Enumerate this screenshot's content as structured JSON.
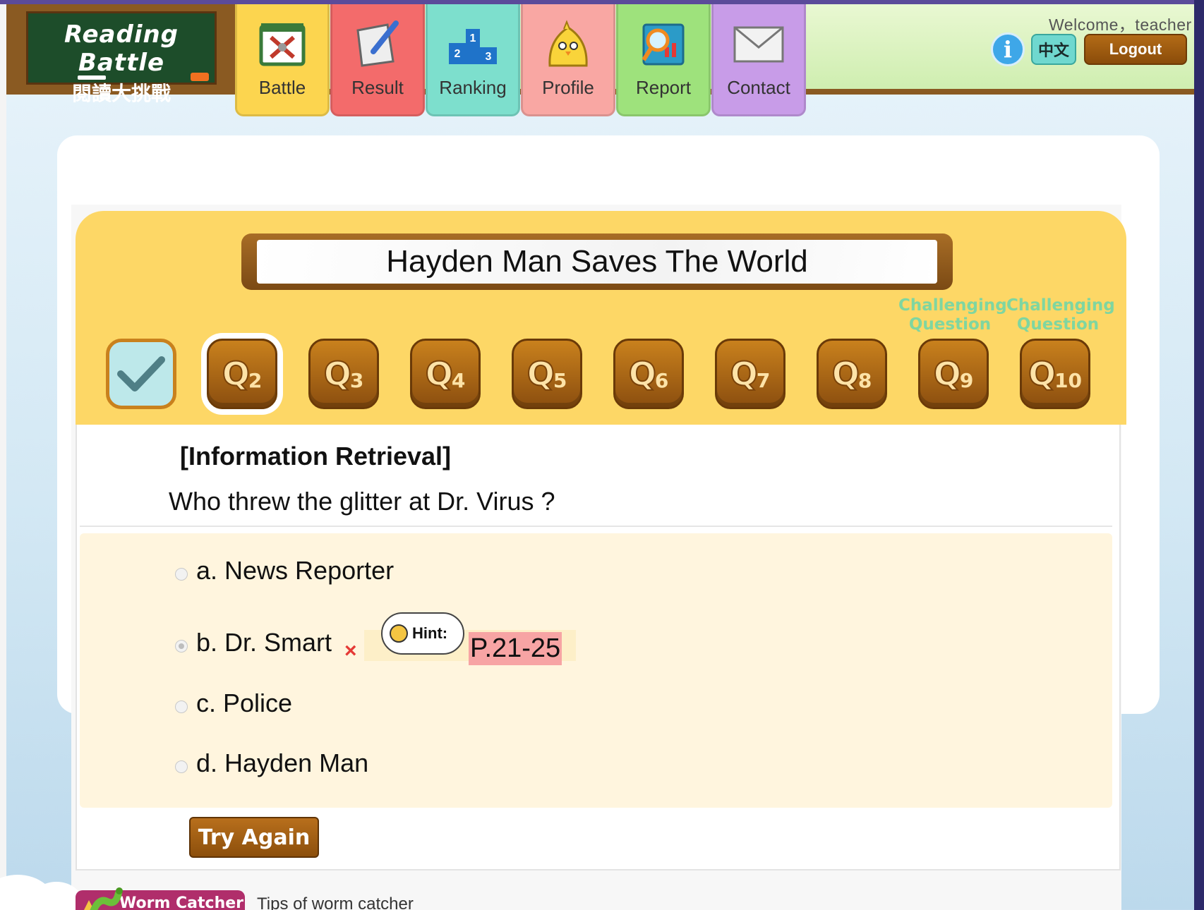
{
  "header": {
    "logo_title": "Reading Battle",
    "logo_subtitle": "閱讀大挑戰",
    "welcome": "Welcome，teacher",
    "info_label": "i",
    "lang_label": "中文",
    "logout_label": "Logout"
  },
  "nav": [
    {
      "label": "Battle",
      "icon": "battle-icon",
      "color": "#fcd54f"
    },
    {
      "label": "Result",
      "icon": "result-icon",
      "color": "#f36b6b"
    },
    {
      "label": "Ranking",
      "icon": "ranking-icon",
      "color": "#7ddfcd"
    },
    {
      "label": "Profile",
      "icon": "profile-icon",
      "color": "#f9a7a3"
    },
    {
      "label": "Report",
      "icon": "report-icon",
      "color": "#9ee27c"
    },
    {
      "label": "Contact",
      "icon": "contact-icon",
      "color": "#c89ce8"
    }
  ],
  "quiz": {
    "book_title": "Hayden Man Saves The World",
    "challenge_label_line1": "Challenging",
    "challenge_label_line2": "Question",
    "questions": [
      {
        "status": "done"
      },
      {
        "letter": "Q",
        "num": "2",
        "status": "active"
      },
      {
        "letter": "Q",
        "num": "3"
      },
      {
        "letter": "Q",
        "num": "4"
      },
      {
        "letter": "Q",
        "num": "5"
      },
      {
        "letter": "Q",
        "num": "6"
      },
      {
        "letter": "Q",
        "num": "7"
      },
      {
        "letter": "Q",
        "num": "8"
      },
      {
        "letter": "Q",
        "num": "9",
        "challenging": true
      },
      {
        "letter": "Q",
        "num": "10",
        "challenging": true
      }
    ],
    "category": "[Information Retrieval]",
    "question": "Who threw the glitter at Dr. Virus ?",
    "options": [
      {
        "label": "a. News Reporter",
        "selected": false
      },
      {
        "label": "b. Dr. Smart",
        "selected": true,
        "wrong": true
      },
      {
        "label": "c. Police",
        "selected": false
      },
      {
        "label": "d. Hayden Man",
        "selected": false
      }
    ],
    "wrong_mark": "×",
    "hint_label": "Hint:",
    "hint_pages": "P.21-25",
    "try_again": "Try Again"
  },
  "footer": {
    "worm_button": "Worm Catcher",
    "worm_tips": "Tips of worm catcher"
  }
}
